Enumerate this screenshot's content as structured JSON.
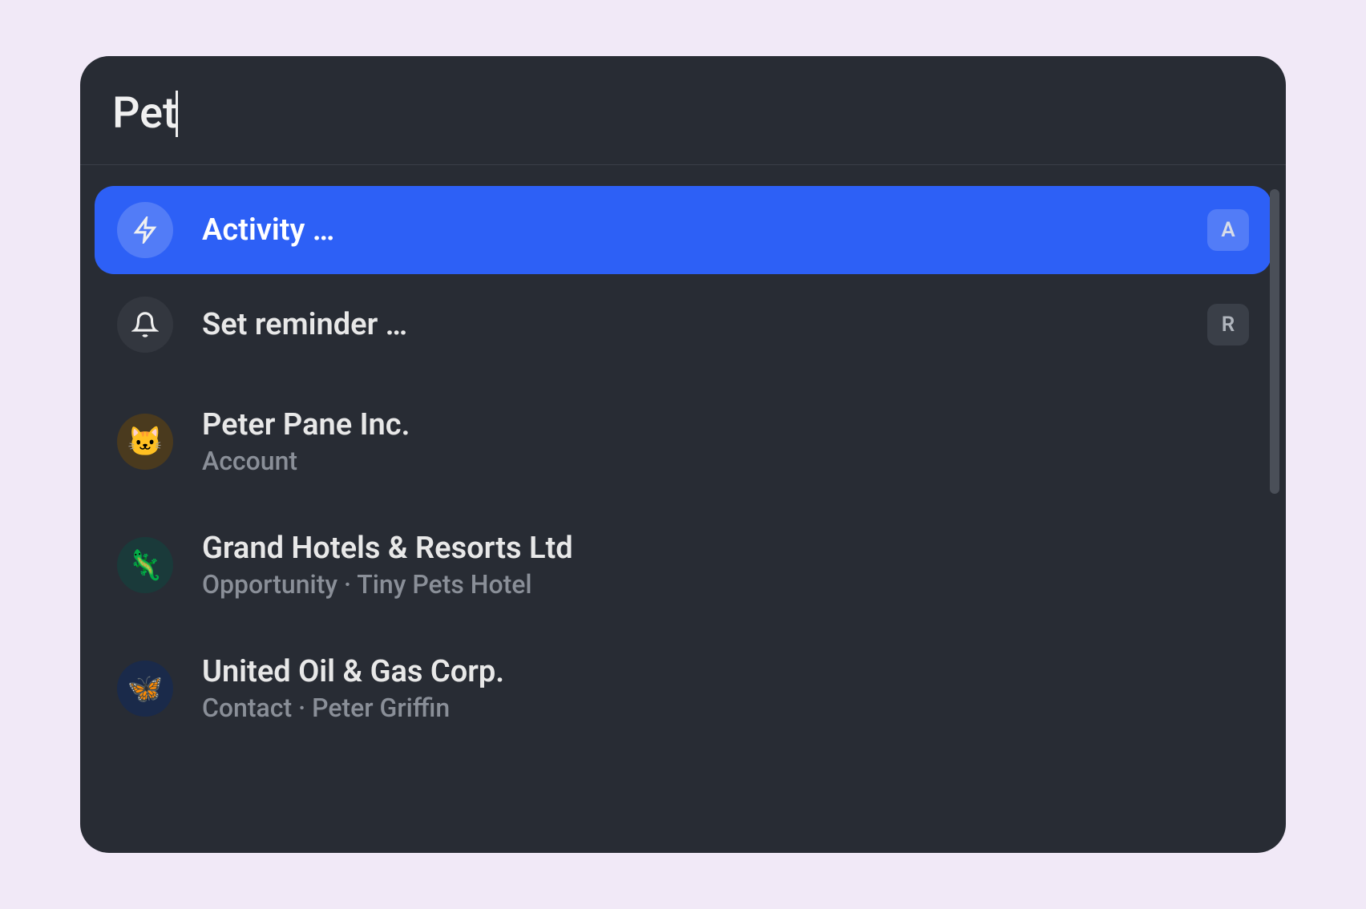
{
  "search": {
    "query": "Pet"
  },
  "results": {
    "actions": [
      {
        "label": "Activity …",
        "icon": "lightning-icon",
        "shortcut": "A",
        "selected": true
      },
      {
        "label": "Set reminder …",
        "icon": "bell-icon",
        "shortcut": "R",
        "selected": false
      }
    ],
    "entities": [
      {
        "title": "Peter Pane Inc.",
        "subtitle": "Account",
        "avatar_emoji": "🐱",
        "avatar_bg": "cat"
      },
      {
        "title": "Grand Hotels & Resorts Ltd",
        "subtitle": "Opportunity · Tiny Pets Hotel",
        "avatar_emoji": "🦎",
        "avatar_bg": "lizard"
      },
      {
        "title": "United Oil & Gas Corp.",
        "subtitle": "Contact · Peter Griffin",
        "avatar_emoji": "🦋",
        "avatar_bg": "butterfly"
      }
    ]
  }
}
